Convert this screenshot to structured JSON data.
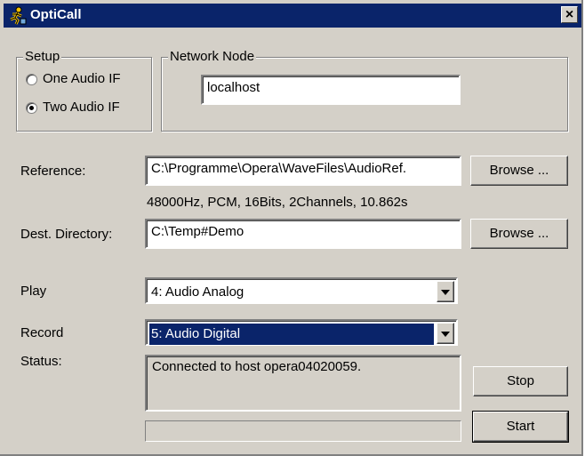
{
  "window": {
    "title": "OptiCall",
    "icon": "running-figure-icon",
    "close_label": "×"
  },
  "setup": {
    "legend": "Setup",
    "options": [
      {
        "label": "One Audio IF",
        "checked": false
      },
      {
        "label": "Two Audio IF",
        "checked": true
      }
    ]
  },
  "network": {
    "legend": "Network Node",
    "value": "localhost"
  },
  "reference": {
    "label": "Reference:",
    "value": "C:\\Programme\\Opera\\WaveFiles\\AudioRef.",
    "browse_label": "Browse ...",
    "info": "48000Hz, PCM, 16Bits, 2Channels, 10.862s"
  },
  "dest": {
    "label": "Dest. Directory:",
    "value": "C:\\Temp#Demo",
    "browse_label": "Browse ..."
  },
  "play": {
    "label": "Play",
    "value": "4: Audio Analog"
  },
  "record": {
    "label": "Record",
    "value": "5: Audio Digital"
  },
  "status": {
    "label": "Status:",
    "text": "Connected to host opera04020059.",
    "progress": 0
  },
  "buttons": {
    "stop": "Stop",
    "start": "Start"
  },
  "colors": {
    "titlebar": "#0a246a",
    "face": "#d4d0c8",
    "selection": "#0a246a"
  }
}
